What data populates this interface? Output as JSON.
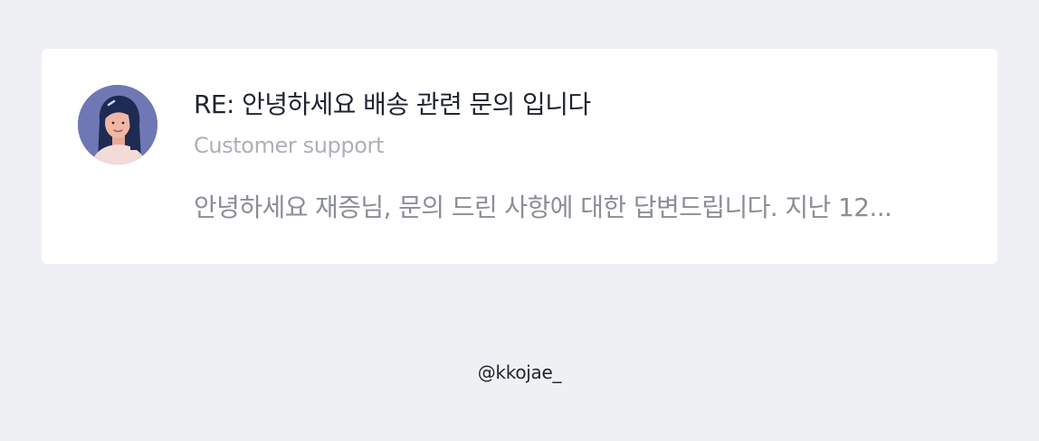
{
  "message": {
    "subject": "RE: 안녕하세요 배송 관련 문의 입니다",
    "sender": "Customer support",
    "preview": "안녕하세요 재증님, 문의 드린 사항에 대한 답변드립니다. 지난 12..."
  },
  "avatar": {
    "icon": "woman-avatar-icon",
    "background_color": "#6f78b4"
  },
  "footer": {
    "credit": "@kkojae_"
  }
}
